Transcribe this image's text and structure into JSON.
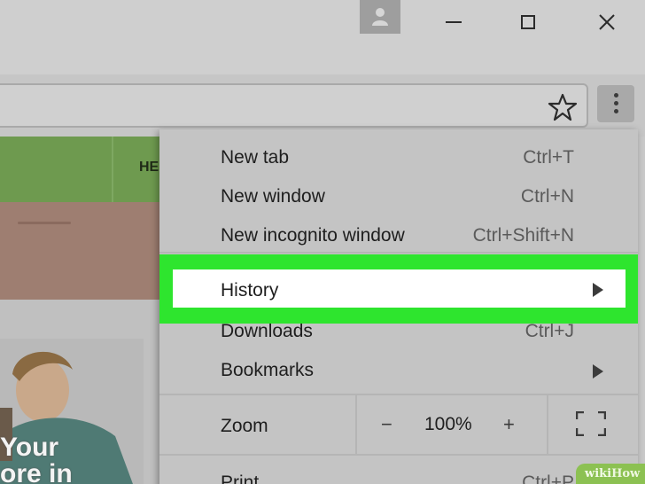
{
  "window": {
    "profile_icon": "person-icon",
    "minimize_icon": "minimize-icon",
    "maximize_icon": "maximize-icon",
    "close_icon": "close-icon"
  },
  "toolbar": {
    "bookmark_icon": "star-icon",
    "menu_icon": "more-vert-icon"
  },
  "page": {
    "nav_text": "HE",
    "card_text_line1": "Your",
    "card_text_line2": "ore in"
  },
  "menu": {
    "items": [
      {
        "label": "New tab",
        "shortcut": "Ctrl+T"
      },
      {
        "label": "New window",
        "shortcut": "Ctrl+N"
      },
      {
        "label": "New incognito window",
        "shortcut": "Ctrl+Shift+N"
      },
      {
        "label": "History",
        "shortcut": ""
      },
      {
        "label": "Downloads",
        "shortcut": "Ctrl+J"
      },
      {
        "label": "Bookmarks",
        "shortcut": ""
      },
      {
        "label": "Print...",
        "shortcut": "Ctrl+P"
      }
    ],
    "zoom": {
      "label": "Zoom",
      "minus": "−",
      "level": "100%",
      "plus": "+"
    },
    "highlight_color": "#2ee52e"
  },
  "watermark": {
    "prefix": "wiki",
    "suffix": "How"
  }
}
